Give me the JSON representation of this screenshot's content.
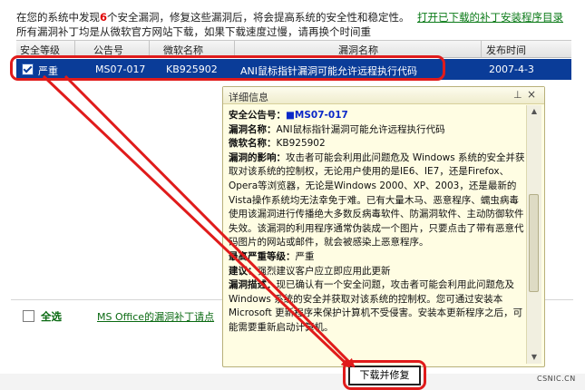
{
  "notice": {
    "part1": "在您的系统中发现",
    "count": "6",
    "part2": "个安全漏洞，修复这些漏洞后，将会提高系统的安全性和稳定性。所有漏洞补丁均是从微软官方网站下载，如果下载速度过慢，请再换个时间重"
  },
  "open_dir_link": "打开已下载的补丁安装程序目录",
  "table": {
    "headers": [
      "安全等级",
      "公告号",
      "微软名称",
      "漏洞名称",
      "发布时间"
    ],
    "rows": [
      {
        "checked": true,
        "level": "严重",
        "bulletin": "MS07-017",
        "kb": "KB925902",
        "name": "ANI鼠标指针漏洞可能允许远程执行代码",
        "date": "2007-4-3"
      }
    ]
  },
  "select_all_label": "全选",
  "office_link": "MS Office的漏洞补丁请点",
  "popup": {
    "title": "详细信息",
    "pin_icon": "pin-icon",
    "close_icon": "close-icon",
    "bulletin_label": "安全公告号：",
    "bulletin_value": "MS07-017",
    "vuln_name_label": "漏洞名称：",
    "vuln_name_value": "ANI鼠标指针漏洞可能允许远程执行代码",
    "ms_name_label": "微软名称：",
    "ms_name_value": "KB925902",
    "impact_label": "漏洞的影响：",
    "impact_value": "攻击者可能会利用此问题危及 Windows 系统的安全并获取对该系统的控制权，无论用户使用的是IE6、IE7，还是Firefox、Opera等浏览器，无论是Windows 2000、XP、2003，还是最新的Vista操作系统均无法幸免于难。已有大量木马、恶意程序、蠕虫病毒使用该漏洞进行传播绝大多数反病毒软件、防漏洞软件、主动防御软件失效。该漏洞的利用程序通常伪装成一个图片，只要点击了带有恶意代码图片的网站或邮件，就会被感染上恶意程序。",
    "severity_label": "最高严重等级：",
    "severity_value": "严重",
    "advice_label": "建议：",
    "advice_value": "强烈建议客户应立即应用此更新",
    "desc_label": "漏洞描述：",
    "desc_value": "现已确认有一个安全问题，攻击者可能会利用此问题危及 Windows 系统的安全并获取对该系统的控制权。您可通过安装本 Microsoft 更新程序来保护计算机不受侵害。安装本更新程序之后，可能需要重新启动计算机。"
  },
  "download_button": "下载并修复",
  "watermark": "CSNIC.CN",
  "colors": {
    "selected_row": "#0a3c98",
    "annotation_red": "#e01b1b",
    "link_green": "#0a6a12",
    "popup_bg": "#fffde3"
  }
}
